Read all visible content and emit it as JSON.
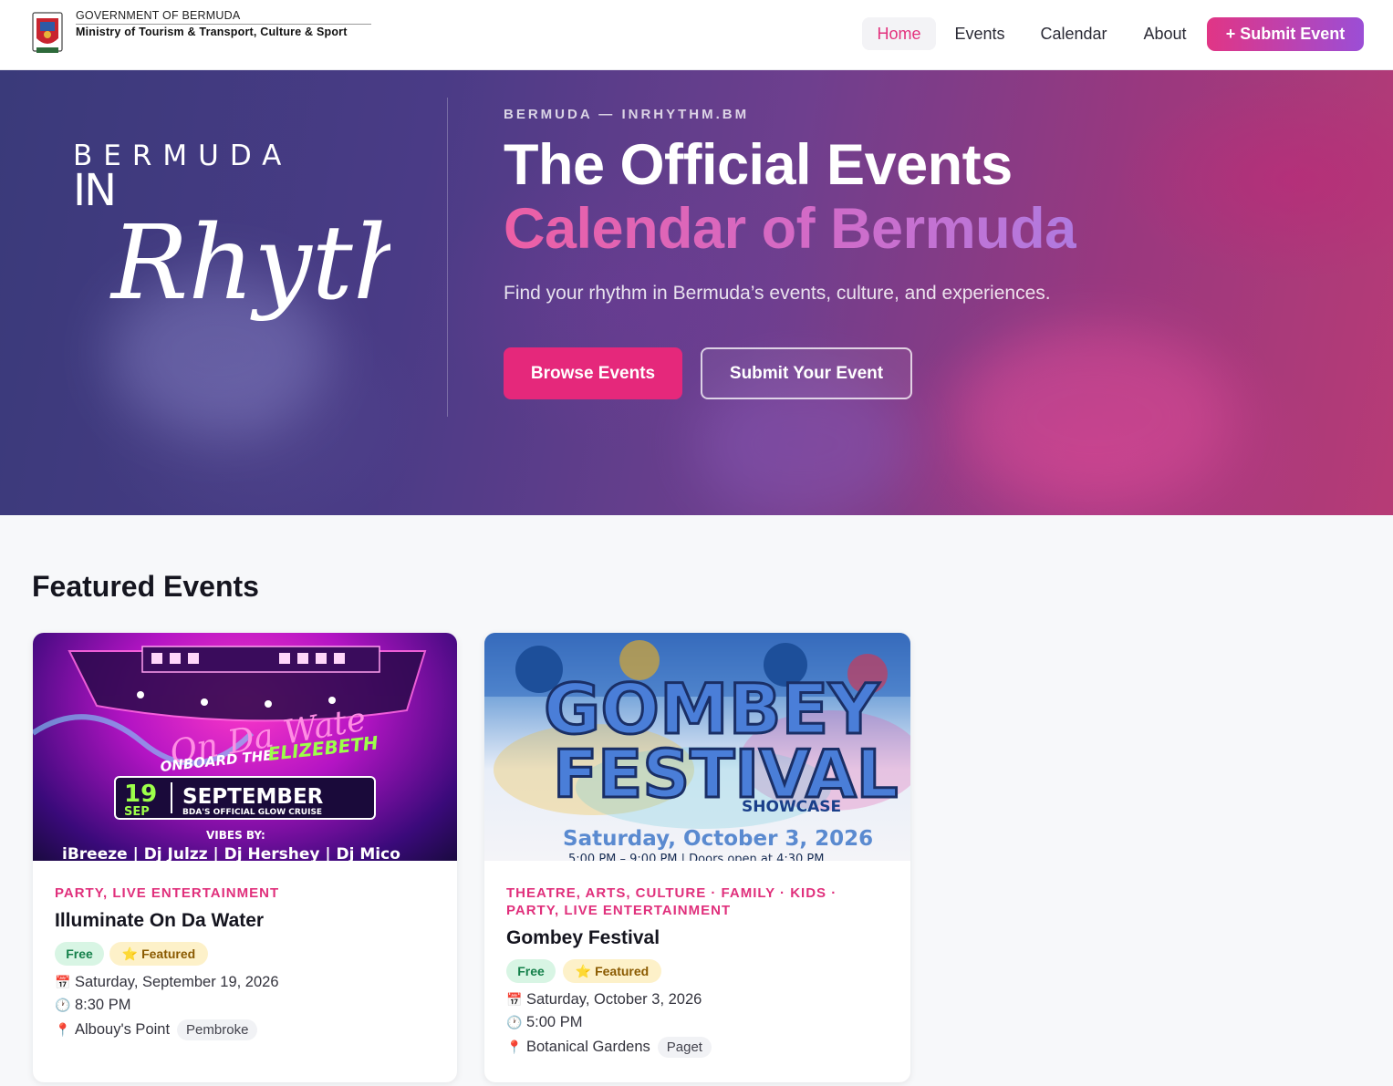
{
  "header": {
    "gov_line": "GOVERNMENT OF BERMUDA",
    "ministry": "Ministry of Tourism & Transport, Culture & Sport",
    "nav": {
      "home": "Home",
      "events": "Events",
      "calendar": "Calendar",
      "about": "About"
    },
    "submit": "+ Submit Event",
    "accent": "#e3317d"
  },
  "hero": {
    "logo_bermuda": "BERMUDA",
    "logo_in": "IN",
    "logo_script": "Rhythm",
    "eyebrow": "BERMUDA — INRHYTHM.BM",
    "title_line1": "The Official Events",
    "title_line2": "Calendar of Bermuda",
    "subtitle": "Find your rhythm in Bermuda’s events, culture, and experiences.",
    "browse_btn": "Browse Events",
    "submit_btn": "Submit Your Event"
  },
  "featured": {
    "title": "Featured Events",
    "events": [
      {
        "categories": "PARTY, LIVE ENTERTAINMENT",
        "title": "Illuminate On Da Water",
        "badge_free": "Free",
        "badge_featured": "⭐ Featured",
        "date": "Saturday, September 19, 2026",
        "time": "8:30 PM",
        "venue": "Albouy's Point",
        "parish": "Pembroke",
        "poster": {
          "script": "On Da Wate",
          "onboard": "ONBOARD THE",
          "ship": "ELIZEBETH",
          "day": "19",
          "mon": "SEP",
          "month": "SEPTEMBER",
          "tag": "BDA'S OFFICIAL GLOW CRUISE",
          "vibes": "VIBES BY:",
          "djs": "iBreeze | Dj Julzz | Dj Hershey | Dj Mico"
        }
      },
      {
        "categories": "THEATRE, ARTS, CULTURE · FAMILY · KIDS · PARTY, LIVE ENTERTAINMENT",
        "title": "Gombey Festival",
        "badge_free": "Free",
        "badge_featured": "⭐ Featured",
        "date": "Saturday, October 3, 2026",
        "time": "5:00 PM",
        "venue": "Botanical Gardens",
        "parish": "Paget",
        "poster": {
          "gombey": "GOMBEY",
          "festival": "FESTIVAL",
          "showcase": "SHOWCASE",
          "date": "Saturday, October 3, 2026",
          "times": "5:00 PM – 9:00 PM | Doors open at 4:30 PM"
        }
      }
    ]
  }
}
